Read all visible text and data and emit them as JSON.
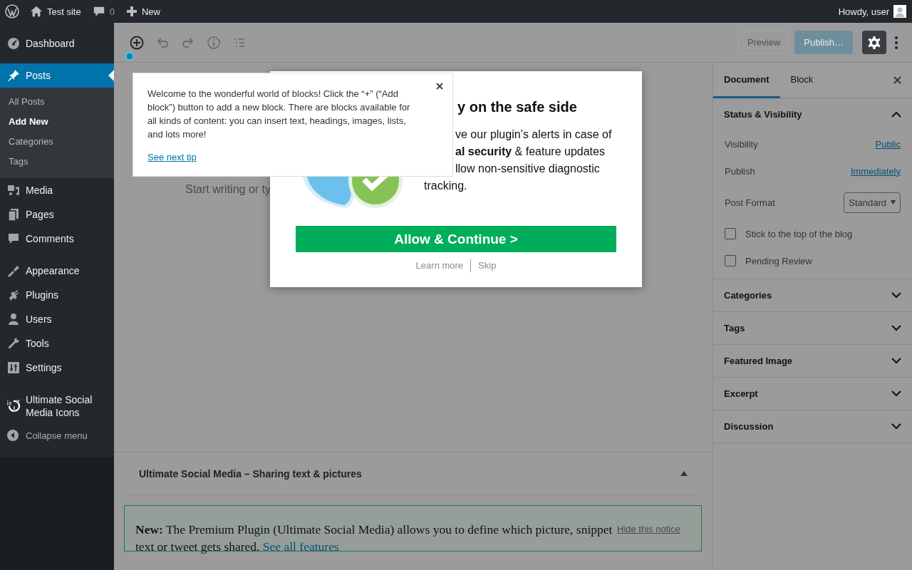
{
  "admin_bar": {
    "site": "Test site",
    "comments": "0",
    "new": "New",
    "greeting": "Howdy, user"
  },
  "menu_groups": [
    {
      "items": [
        {
          "label": "Dashboard",
          "selected": false
        }
      ]
    },
    {
      "items": [
        {
          "label": "Posts",
          "selected": true,
          "children": [
            {
              "label": "All Posts",
              "selected": false
            },
            {
              "label": "Add New",
              "selected": true
            },
            {
              "label": "Categories",
              "selected": false
            },
            {
              "label": "Tags",
              "selected": false
            }
          ]
        },
        {
          "label": "Media",
          "selected": false
        },
        {
          "label": "Pages",
          "selected": false
        },
        {
          "label": "Comments",
          "selected": false
        }
      ]
    },
    {
      "items": [
        {
          "label": "Appearance",
          "selected": false
        },
        {
          "label": "Plugins",
          "selected": false
        },
        {
          "label": "Users",
          "selected": false
        },
        {
          "label": "Tools",
          "selected": false
        },
        {
          "label": "Settings",
          "selected": false
        }
      ]
    },
    {
      "items": [
        {
          "label": "Ultimate Social Media Icons",
          "selected": false
        }
      ]
    }
  ],
  "collapse": "Collapse menu",
  "toolbar": {
    "preview": "Preview",
    "publish": "Publish…"
  },
  "editor": {
    "placeholder": "Start writing or ty"
  },
  "tip": {
    "text": "Welcome to the wonderful world of blocks! Click the “+” (“Add block”) button to add a new block. There are blocks available for all kinds of content: you can insert text, headings, images, lists, and lots more!",
    "link": "See next tip"
  },
  "modal": {
    "heading": "y on the safe side",
    "body_lines": [
      "ve our plugin’s alerts in case of",
      "**al security** & feature updates",
      "llow non-sensitive diagnostic",
      "tracking."
    ],
    "button": "Allow & Continue >",
    "links": [
      "Learn more",
      "Skip"
    ]
  },
  "settings": {
    "tabs": [
      {
        "label": "Document",
        "selected": true
      },
      {
        "label": "Block",
        "selected": false
      }
    ],
    "status_panel": {
      "title": "Status & Visibility",
      "expanded": true,
      "rows": [
        {
          "kind": "link",
          "label": "Visibility",
          "value": "Public"
        },
        {
          "kind": "link",
          "label": "Publish",
          "value": "Immediately"
        },
        {
          "kind": "select",
          "label": "Post Format",
          "value": "Standard"
        },
        {
          "kind": "checkbox",
          "label": "Stick to the top of the blog",
          "checked": false
        },
        {
          "kind": "checkbox",
          "label": "Pending Review",
          "checked": false
        }
      ]
    },
    "panels": [
      {
        "title": "Categories",
        "expanded": false
      },
      {
        "title": "Tags",
        "expanded": false
      },
      {
        "title": "Featured Image",
        "expanded": false
      },
      {
        "title": "Excerpt",
        "expanded": false
      },
      {
        "title": "Discussion",
        "expanded": false
      }
    ]
  },
  "metabox": {
    "title": "Ultimate Social Media – Sharing text & pictures",
    "expanded": true,
    "notice": {
      "text": "**New:** The Premium Plugin (Ultimate Social Media) allows you to define which picture, snippet text or tweet gets shared.",
      "link": "See all features",
      "dismiss": "Hide this notice"
    }
  }
}
